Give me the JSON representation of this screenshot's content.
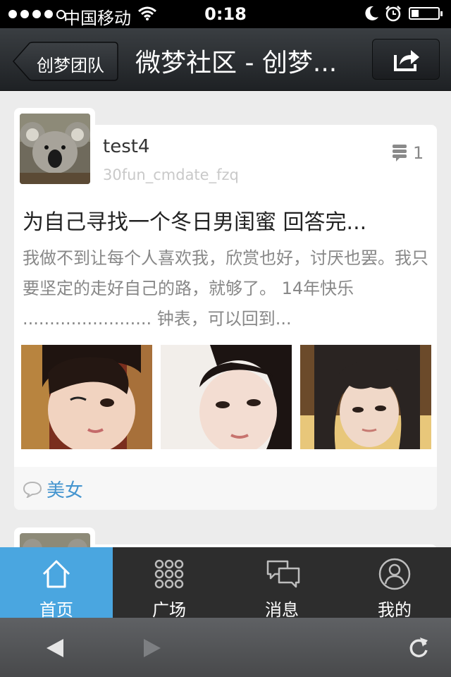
{
  "status_bar": {
    "carrier": "中国移动",
    "time": "0:18",
    "signal_bars": 4,
    "battery_level": 0.25,
    "icons": [
      "signal-dots-icon",
      "wifi-icon",
      "moon-icon",
      "alarm-clock-icon",
      "battery-icon"
    ]
  },
  "nav": {
    "back_label": "创梦团队",
    "title": "微梦社区 - 创梦...",
    "share_icon": "share-icon"
  },
  "post": {
    "username": "test4",
    "user_id": "30fun_cmdate_fzq",
    "comment_count": "1",
    "title": "为自己寻找一个冬日男闺蜜 回答完...",
    "body": "我做不到让每个人喜欢我，欣赏也好，讨厌也罢。我只要坚定的走好自己的路，就够了。 14年快乐 ........................ 钟表，可以回到...",
    "tag": "美女",
    "images": [
      "photo-1",
      "photo-2",
      "photo-3"
    ]
  },
  "tabs": [
    {
      "label": "首页",
      "icon": "home-icon",
      "active": true
    },
    {
      "label": "广场",
      "icon": "grid-icon",
      "active": false
    },
    {
      "label": "消息",
      "icon": "chat-bubbles-icon",
      "active": false
    },
    {
      "label": "我的",
      "icon": "user-icon",
      "active": false
    }
  ],
  "browser": {
    "icons": [
      "back-arrow-icon",
      "forward-arrow-icon",
      "reload-icon"
    ]
  },
  "colors": {
    "accent": "#4aa6e0",
    "tag_link": "#4595cf",
    "navbar": "#2b2e31",
    "tabbar": "#2d2d2d"
  }
}
